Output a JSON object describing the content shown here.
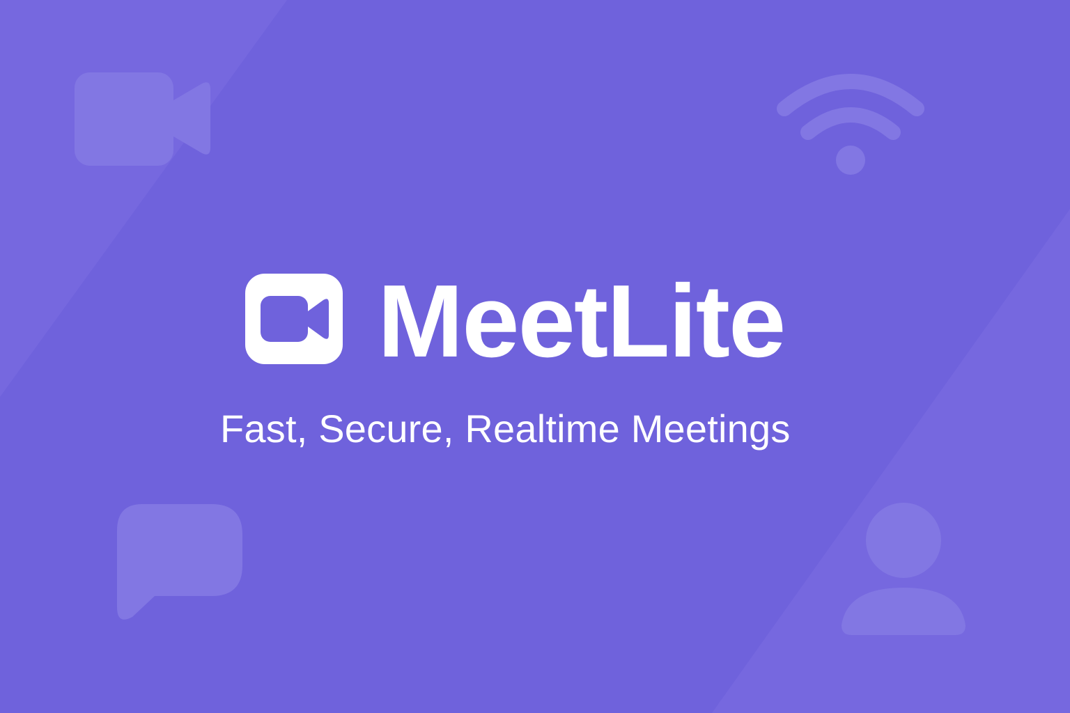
{
  "colors": {
    "background": "#6f62dc",
    "background_band": "#7668df",
    "decor_shape": "#8277e3",
    "foreground": "#ffffff"
  },
  "brand": {
    "name": "MeetLite",
    "tagline": "Fast, Secure, Realtime Meetings",
    "logo_icon": "video-camera-icon"
  },
  "decorations": [
    "video-camera-icon",
    "wifi-icon",
    "chat-bubble-icon",
    "user-icon"
  ]
}
